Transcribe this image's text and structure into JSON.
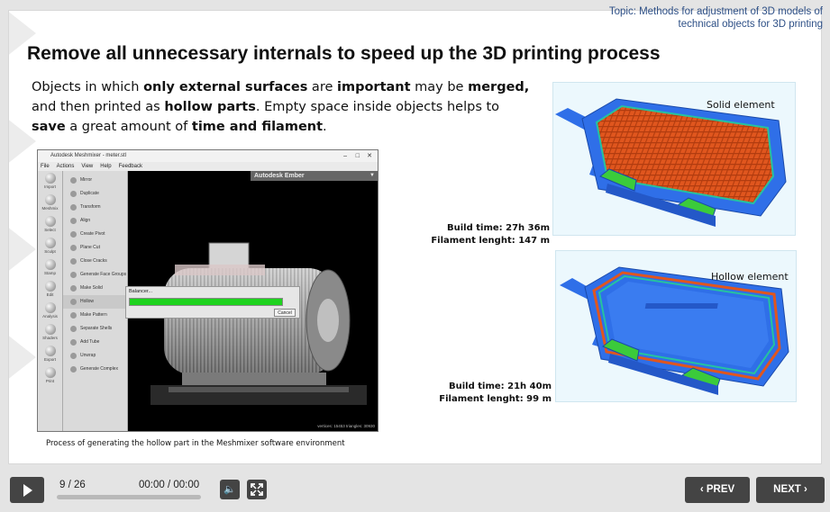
{
  "topic": {
    "line1": "Topic: Methods for adjustment of 3D models of",
    "line2": "technical objects for 3D printing"
  },
  "title": "Remove all unnecessary internals to speed up the 3D printing process",
  "description": {
    "p1": "Objects in which ",
    "b1": "only external surfaces",
    "p2": " are ",
    "b2": "important",
    "p3": " may be ",
    "b3": "merged,",
    "p4": " and then printed as ",
    "b4": "hollow parts",
    "p5": ". Empty space inside objects helps to ",
    "b5": "save",
    "p6": " a great amount of ",
    "b6": "time and filament",
    "p7": "."
  },
  "meshmixer": {
    "window_title": "Autodesk Meshmixer - meter.stl",
    "menu": [
      "File",
      "Actions",
      "View",
      "Help",
      "Feedback"
    ],
    "tools": [
      "Import",
      "Meshmix",
      "Select",
      "Sculpt",
      "Stamp",
      "Edit",
      "Analysis",
      "Shaders",
      "Export",
      "Print"
    ],
    "edit_menu": [
      "Mirror",
      "Duplicate",
      "Transform",
      "Align",
      "Create Pivot",
      "Plane Cut",
      "Close Cracks",
      "Generate Face Groups",
      "Make Solid",
      "Hollow",
      "Make Pattern",
      "Separate Shells",
      "Add Tube",
      "Unwrap",
      "Generate Complex"
    ],
    "selected_item": "Hollow",
    "printer_label": "Autodesk Ember",
    "status": "vertices: 15453 triangles: 30930",
    "dialog_title": "Balancer...",
    "dialog_progress": 0.92,
    "dialog_cancel": "Cancel",
    "caption": "Process of generating the hollow part in the Meshmixer software environment"
  },
  "solid": {
    "label": "Solid element",
    "build_time": "Build time: 27h 36m",
    "filament": "Filament lenght: 147 m"
  },
  "hollow": {
    "label": "Hollow element",
    "build_time": "Build time: 21h 40m",
    "filament": "Filament lenght: 99 m"
  },
  "controls": {
    "counter": "9 / 26",
    "time": "00:00 / 00:00",
    "progress": 0.0,
    "prev": "PREV",
    "next": "NEXT"
  },
  "colors": {
    "accent_text": "#2d4f86",
    "part_blue": "#2f6fe8",
    "fill_orange": "#e0561e",
    "pad_green": "#3bcb3b",
    "progress_green": "#1ed31e"
  }
}
